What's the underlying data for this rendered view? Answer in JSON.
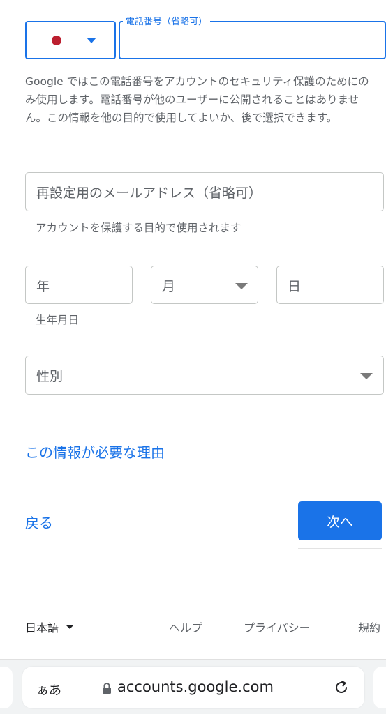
{
  "phone": {
    "label": "電話番号（省略可）",
    "value": ""
  },
  "country_selector": {
    "flag": "japan-flag-icon",
    "dropdown_icon": "chevron-down-icon"
  },
  "notice": "Google ではこの電話番号をアカウントのセキュリティ保護のためにのみ使用します。電話番号が他のユーザーに公開されることはありません。この情報を他の目的で使用してよいか、後で選択できます。",
  "recovery_email": {
    "placeholder": "再設定用のメールアドレス（省略可）",
    "helper": "アカウントを保護する目的で使用されます"
  },
  "birthday": {
    "year_placeholder": "年",
    "month_placeholder": "月",
    "day_placeholder": "日",
    "helper": "生年月日"
  },
  "gender": {
    "placeholder": "性別"
  },
  "why_link": "この情報が必要な理由",
  "back_label": "戻る",
  "next_label": "次へ",
  "footer": {
    "language": "日本語",
    "help": "ヘルプ",
    "privacy": "プライバシー",
    "terms": "規約"
  },
  "browser": {
    "text_size": "ぁあ",
    "url": "accounts.google.com",
    "lock_icon": "lock-icon",
    "reload_icon": "reload-icon"
  },
  "colors": {
    "accent": "#1a73e8",
    "flag_red": "#bc1f2f"
  }
}
